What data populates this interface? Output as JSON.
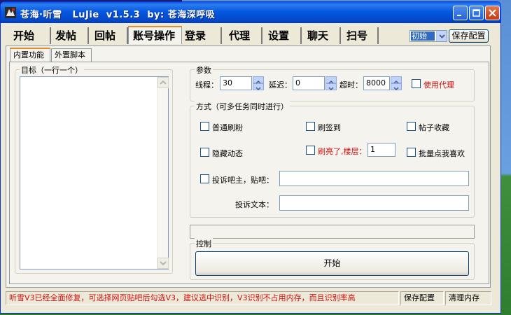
{
  "window": {
    "title": "苍海·听雪   LuJie  v1.5.3  by: 苍海深呼吸"
  },
  "main_tabs": [
    {
      "label": "开始"
    },
    {
      "label": "发帖"
    },
    {
      "label": "回帖"
    },
    {
      "label": "账号操作"
    },
    {
      "label": "登录"
    },
    {
      "label": "代理"
    },
    {
      "label": "设置"
    },
    {
      "label": "聊天"
    },
    {
      "label": "扫号"
    }
  ],
  "preset": {
    "selected": "初始"
  },
  "save_config_label": "保存配置",
  "sub_tabs": [
    {
      "label": "内置功能"
    },
    {
      "label": "外置脚本"
    }
  ],
  "target": {
    "label": "目标（一行一个）"
  },
  "params": {
    "group_label": "参数",
    "threads_label": "线程：",
    "threads_value": "30",
    "delay_label": "延迟：",
    "delay_value": "0",
    "timeout_label": "超时：",
    "timeout_value": "8000",
    "use_proxy_label": "使用代理"
  },
  "modes": {
    "group_label": "方式（可多任务同时进行）",
    "normal_fans": "普通刷粉",
    "sign_in": "刷签到",
    "favorite_post": "帖子收藏",
    "hide_feed": "隐藏动态",
    "bright_floor_label": "刷亮了,楼层：",
    "bright_floor_value": "1",
    "batch_like": "批量点我喜欢",
    "complain_label": "投诉吧主，贴吧：",
    "complain_text_label": "投诉文本："
  },
  "control": {
    "group_label": "控制",
    "start_label": "开始"
  },
  "status": {
    "message": "听雪V3已经全面修复，可选择网页贴吧后勾选V3，建议选中识别，V3识别不占用内存，而且识别率高",
    "save_config": "保存配置",
    "clear_memory": "清理内存"
  },
  "background": {
    "strip_text": ""
  },
  "colors": {
    "titlebar": "#0558e0",
    "active_tab_accent": "#e68b2c",
    "warning_text": "#d01010",
    "window_bg": "#ece9d8"
  },
  "icons": {
    "app": "app-logo-icon",
    "minimize": "minimize-icon",
    "maximize": "maximize-icon",
    "close": "close-icon"
  }
}
